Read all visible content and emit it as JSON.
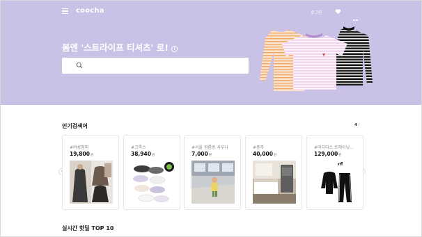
{
  "header": {
    "logo": "coocha",
    "login_label": "로그인",
    "icons": [
      "menu-icon",
      "heart-icon",
      "more-icon"
    ]
  },
  "hero": {
    "title": "봄엔 '스트라이프 티셔츠' 로!",
    "info_icon_glyph": "i",
    "search_placeholder": "",
    "background": "#c9c2e6"
  },
  "popular": {
    "title": "인기검색어",
    "page_current": "4",
    "page_suffix": "/",
    "cards": [
      {
        "tag": "#여성점퍼",
        "price": "19,800",
        "unit": "원",
        "image": "women-jacket-photo"
      },
      {
        "tag": "#크록스",
        "price": "38,940",
        "unit": "원",
        "image": "crocs-shoes-photo"
      },
      {
        "tag": "#서울 원룸방 사우나",
        "price": "7,000",
        "unit": "원",
        "image": "room-interior-photo"
      },
      {
        "tag": "#충주",
        "price": "40,000",
        "unit": "원",
        "image": "hotel-room-photo"
      },
      {
        "tag": "#아디다스 트레이닝…",
        "price": "129,000",
        "unit": "원",
        "image": "adidas-tracksuit-photo"
      }
    ]
  },
  "realtime": {
    "title": "실시간 핫딜 TOP 10"
  },
  "arrows": {
    "prev": "‹",
    "next": "›"
  }
}
